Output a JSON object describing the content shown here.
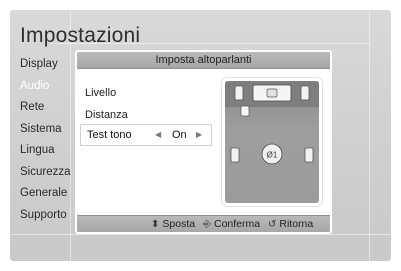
{
  "page": {
    "title": "Impostazioni"
  },
  "menu": {
    "items": [
      {
        "label": "Display",
        "active": false
      },
      {
        "label": "Audio",
        "active": true
      },
      {
        "label": "Rete",
        "active": false
      },
      {
        "label": "Sistema",
        "active": false
      },
      {
        "label": "Lingua",
        "active": false
      },
      {
        "label": "Sicurezza",
        "active": false
      },
      {
        "label": "Generale",
        "active": false
      },
      {
        "label": "Supporto",
        "active": false
      }
    ]
  },
  "dialog": {
    "title": "Imposta altoparlanti",
    "options": {
      "livello": "Livello",
      "distanza": "Distanza",
      "test_tono": {
        "label": "Test tono",
        "value": "On"
      }
    },
    "speaker_diagram": {
      "center_label": "Ø1"
    },
    "footer": {
      "move": {
        "icon": "up-down-arrows-icon",
        "label": "Sposta"
      },
      "confirm": {
        "icon": "enter-key-icon",
        "label": "Conferma"
      },
      "back": {
        "icon": "return-icon",
        "label": "Ritorna"
      }
    }
  }
}
